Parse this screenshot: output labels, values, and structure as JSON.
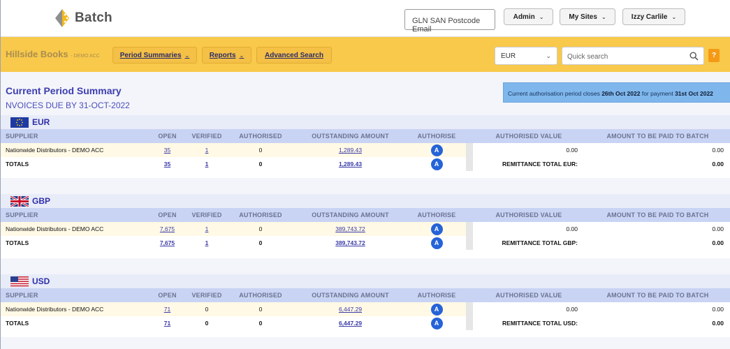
{
  "header": {
    "logo_text": "Batch",
    "search_placeholder": "GLN SAN Postcode Email",
    "admin_label": "Admin",
    "mysites_label": "My Sites",
    "user_label": "Izzy Carlile"
  },
  "nav": {
    "brand": "Hillside Books",
    "brand_suffix": "- DEMO ACC",
    "period_summaries": "Period Summaries",
    "reports": "Reports",
    "advanced_search": "Advanced Search",
    "currency": "EUR",
    "quick_search_placeholder": "Quick search",
    "help": "?"
  },
  "page": {
    "title": "Current Period Summary",
    "subtitle": "NVOICES DUE BY 31-OCT-2022",
    "notice_prefix": "Current authorisation period closes ",
    "notice_close_date": "26th Oct 2022",
    "notice_middle": " for payment ",
    "notice_payment_date": "31st Oct 2022"
  },
  "columns": {
    "supplier": "SUPPLIER",
    "open": "OPEN",
    "verified": "VERIFIED",
    "authorised": "AUTHORISED",
    "outstanding": "OUTSTANDING AMOUNT",
    "authorise": "AUTHORISE",
    "authorised_value": "AUTHORISED VALUE",
    "amount_to_batch": "AMOUNT TO BE PAID TO BATCH"
  },
  "authorise_icon_letter": "A",
  "currencies": [
    {
      "code": "EUR",
      "row": {
        "supplier": "Nationwide Distributors - DEMO ACC",
        "open": "35",
        "verified": "1",
        "authorised": "0",
        "outstanding": "1,289.43",
        "authorised_value": "0.00",
        "to_batch": "0.00"
      },
      "totals": {
        "label": "TOTALS",
        "open": "35",
        "verified": "1",
        "authorised": "0",
        "outstanding": "1,289.43",
        "remittance_label": "REMITTANCE TOTAL EUR:",
        "to_batch": "0.00"
      }
    },
    {
      "code": "GBP",
      "row": {
        "supplier": "Nationwide Distributors - DEMO ACC",
        "open": "7,675",
        "verified": "1",
        "authorised": "0",
        "outstanding": "389,743.72",
        "authorised_value": "0.00",
        "to_batch": "0.00"
      },
      "totals": {
        "label": "TOTALS",
        "open": "7,675",
        "verified": "1",
        "authorised": "0",
        "outstanding": "389,743.72",
        "remittance_label": "REMITTANCE TOTAL GBP:",
        "to_batch": "0.00"
      }
    },
    {
      "code": "USD",
      "row": {
        "supplier": "Nationwide Distributors - DEMO ACC",
        "open": "71",
        "verified": "0",
        "authorised": "0",
        "outstanding": "6,447.29",
        "authorised_value": "0.00",
        "to_batch": "0.00"
      },
      "totals": {
        "label": "TOTALS",
        "open": "71",
        "verified": "0",
        "authorised": "0",
        "outstanding": "6,447.29",
        "remittance_label": "REMITTANCE TOTAL USD:",
        "to_batch": "0.00"
      }
    }
  ]
}
